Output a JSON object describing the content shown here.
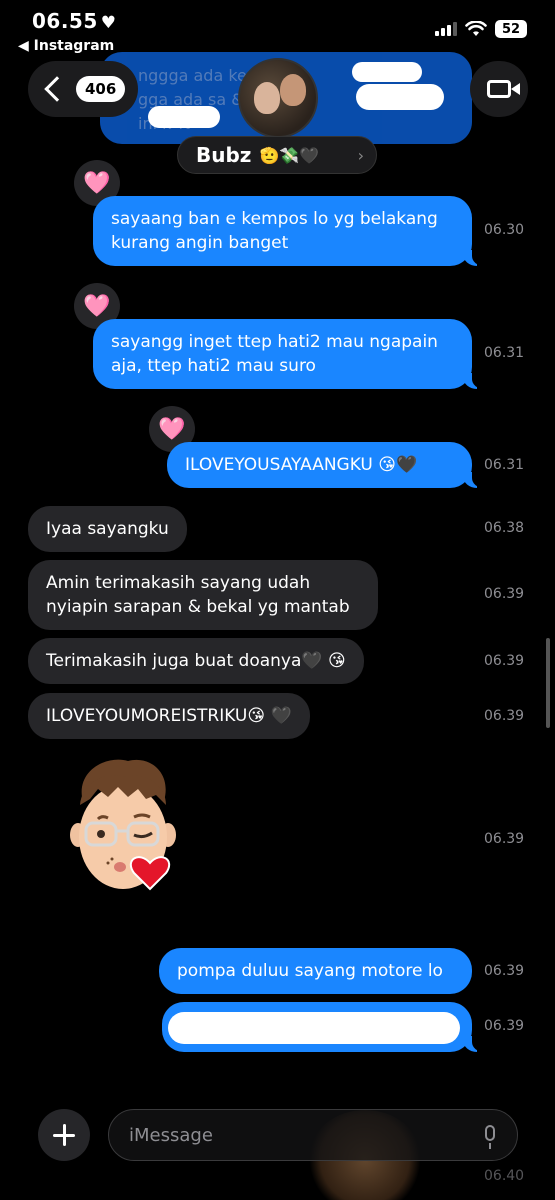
{
  "status_bar": {
    "time": "06.55",
    "heart": "♥",
    "back_app": "◀ Instagram",
    "battery": "52"
  },
  "header": {
    "unread_count": "406",
    "contact_name": "Bubz",
    "name_emojis": "🫡💸🖤",
    "chevron": "›",
    "ghost_lines": [
      "nggga ada kem     ngga",
      "gga ada sa          & o",
      "ini k        %"
    ]
  },
  "messages": [
    {
      "side": "sent",
      "text": "sayaang ban e kempos lo yg belakang kurang angin banget",
      "time": "06.30",
      "reaction": "🩷"
    },
    {
      "side": "sent",
      "text": "sayangg inget ttep hati2 mau ngapain aja, ttep hati2 mau suro",
      "time": "06.31",
      "reaction": "🩷"
    },
    {
      "side": "sent",
      "text": "ILOVEYOUSAYAANGKU 😘🖤",
      "time": "06.31",
      "reaction": "🩷"
    },
    {
      "side": "recv",
      "text": "Iyaa sayangku",
      "time": "06.38"
    },
    {
      "side": "recv",
      "text": "Amin terimakasih sayang udah nyiapin sarapan & bekal yg mantab",
      "time": "06.39"
    },
    {
      "side": "recv",
      "text": "Terimakasih juga buat doanya🖤 😘",
      "time": "06.39"
    },
    {
      "side": "recv",
      "text": "ILOVEYOUMOREISTRIKU😘 🖤",
      "time": "06.39"
    },
    {
      "side": "recv",
      "sticker": "memoji-kiss",
      "time": "06.39"
    },
    {
      "side": "sent",
      "text": "pompa duluu sayang motore lo",
      "time": "06.39"
    },
    {
      "side": "sent",
      "text": "",
      "redacted": true,
      "time": "06.39"
    }
  ],
  "composer": {
    "placeholder": "iMessage",
    "partial_time": "06.40"
  },
  "colors": {
    "sent_bubble": "#1a86ff",
    "recv_bubble": "#262629",
    "background": "#000000"
  }
}
